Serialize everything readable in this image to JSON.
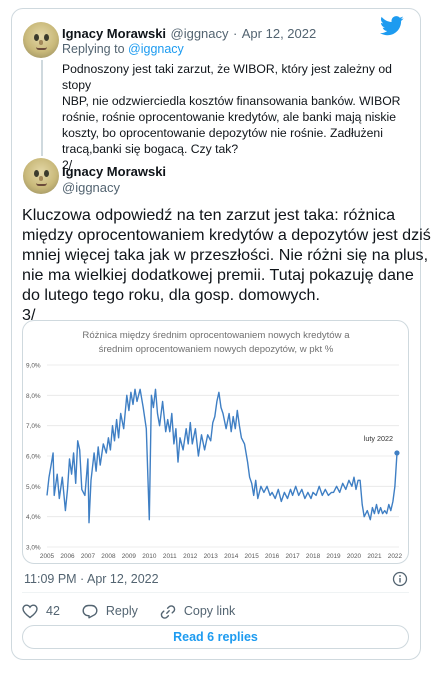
{
  "reply_tweet": {
    "author_name": "Ignacy Morawski",
    "handle": "@iggnacy",
    "dot": "·",
    "date": "Apr 12, 2022",
    "replying_prefix": "Replying to",
    "replying_to": "@iggnacy",
    "lines": [
      "Podnoszony jest taki zarzut, że WIBOR, który jest zależny od stopy",
      "NBP, nie odzwierciedla kosztów finansowania banków. WIBOR",
      "rośnie, rośnie oprocentowanie kredytów, ale banki mają niskie",
      "koszty, bo oprocentowanie depozytów nie rośnie. Zadłużeni",
      "tracą,banki się bogacą. Czy tak?",
      "2/"
    ]
  },
  "main_tweet": {
    "author_name": "Ignacy Morawski",
    "handle": "@iggnacy",
    "lines": [
      "Kluczowa odpowiedź na ten zarzut jest taka: różnica",
      "między oprocentowaniem kredytów a depozytów jest dziś",
      "mniej więcej taka jak w przeszłości. Nie różni się na plus,",
      "nie ma wielkiej dodatkowej premii. Tutaj pokazuję dane",
      "do lutego tego roku, dla gosp. domowych.",
      "3/"
    ],
    "timestamp": "11:09 PM · Apr 12, 2022",
    "like_count": "42",
    "reply_label": "Reply",
    "copy_link_label": "Copy link",
    "read_replies_label": "Read 6 replies"
  },
  "colors": {
    "line": "#3f7fc4",
    "twitter_blue": "#1d9bf0",
    "grid": "#e6e6e6"
  },
  "icons": {
    "logo": "twitter-bird-icon",
    "like": "heart-icon",
    "reply": "speech-bubble-icon",
    "copy_link": "link-icon",
    "info": "info-icon"
  },
  "chart_data": {
    "type": "line",
    "title": "Różnica między średnim oprocentowaniem nowych kredytów a średnim oprocentowaniem nowych depozytów, w pkt %",
    "title_lines": [
      "Różnica między średnim oprocentowaniem nowych kredytów a",
      "średnim oprocentowaniem nowych depozytów, w pkt %"
    ],
    "xlabel": "",
    "ylabel": "",
    "ylim": [
      3.0,
      9.0
    ],
    "xlim": [
      2005.0,
      2022.2
    ],
    "yticks": [
      "3,0%",
      "4,0%",
      "5,0%",
      "6,0%",
      "7,0%",
      "8,0%",
      "9,0%"
    ],
    "ytick_values": [
      3,
      4,
      5,
      6,
      7,
      8,
      9
    ],
    "xticks": [
      "2005",
      "2006",
      "2007",
      "2008",
      "2009",
      "2010",
      "2011",
      "2012",
      "2013",
      "2014",
      "2015",
      "2016",
      "2017",
      "2018",
      "2019",
      "2020",
      "2021",
      "2022"
    ],
    "grid": true,
    "annotation": "luty 2022",
    "last_point": [
      2022.1,
      6.1
    ],
    "series": [
      {
        "values": [
          [
            2005.0,
            4.7
          ],
          [
            2005.1,
            5.3
          ],
          [
            2005.2,
            5.7
          ],
          [
            2005.3,
            6.1
          ],
          [
            2005.35,
            4.7
          ],
          [
            2005.5,
            5.4
          ],
          [
            2005.6,
            4.6
          ],
          [
            2005.75,
            5.3
          ],
          [
            2005.9,
            4.2
          ],
          [
            2006.0,
            4.9
          ],
          [
            2006.1,
            5.9
          ],
          [
            2006.2,
            5.4
          ],
          [
            2006.3,
            6.1
          ],
          [
            2006.4,
            5.1
          ],
          [
            2006.5,
            6.5
          ],
          [
            2006.6,
            6.2
          ],
          [
            2006.7,
            4.9
          ],
          [
            2006.85,
            4.7
          ],
          [
            2007.0,
            5.9
          ],
          [
            2007.05,
            3.8
          ],
          [
            2007.15,
            5.2
          ],
          [
            2007.3,
            6.1
          ],
          [
            2007.4,
            5.5
          ],
          [
            2007.5,
            6.3
          ],
          [
            2007.6,
            5.7
          ],
          [
            2007.75,
            6.4
          ],
          [
            2007.9,
            6.1
          ],
          [
            2008.0,
            6.6
          ],
          [
            2008.1,
            6.2
          ],
          [
            2008.2,
            7.0
          ],
          [
            2008.3,
            6.5
          ],
          [
            2008.4,
            7.2
          ],
          [
            2008.5,
            6.6
          ],
          [
            2008.6,
            7.4
          ],
          [
            2008.75,
            6.9
          ],
          [
            2008.9,
            8.0
          ],
          [
            2009.0,
            7.5
          ],
          [
            2009.1,
            8.1
          ],
          [
            2009.2,
            7.7
          ],
          [
            2009.3,
            8.2
          ],
          [
            2009.4,
            7.8
          ],
          [
            2009.55,
            8.2
          ],
          [
            2009.7,
            7.6
          ],
          [
            2009.85,
            6.9
          ],
          [
            2010.0,
            3.9
          ],
          [
            2010.1,
            8.0
          ],
          [
            2010.2,
            7.6
          ],
          [
            2010.3,
            8.2
          ],
          [
            2010.4,
            7.4
          ],
          [
            2010.5,
            7.0
          ],
          [
            2010.65,
            7.8
          ],
          [
            2010.8,
            6.8
          ],
          [
            2010.9,
            7.2
          ],
          [
            2011.0,
            6.8
          ],
          [
            2011.1,
            7.4
          ],
          [
            2011.2,
            6.4
          ],
          [
            2011.3,
            6.9
          ],
          [
            2011.4,
            5.8
          ],
          [
            2011.5,
            6.6
          ],
          [
            2011.65,
            6.2
          ],
          [
            2011.8,
            6.9
          ],
          [
            2011.9,
            6.4
          ],
          [
            2012.0,
            7.1
          ],
          [
            2012.1,
            6.4
          ],
          [
            2012.25,
            6.9
          ],
          [
            2012.4,
            6.0
          ],
          [
            2012.55,
            6.7
          ],
          [
            2012.7,
            6.2
          ],
          [
            2012.85,
            6.7
          ],
          [
            2013.0,
            6.5
          ],
          [
            2013.1,
            7.1
          ],
          [
            2013.2,
            7.3
          ],
          [
            2013.3,
            7.8
          ],
          [
            2013.4,
            8.1
          ],
          [
            2013.5,
            7.6
          ],
          [
            2013.6,
            7.4
          ],
          [
            2013.75,
            6.9
          ],
          [
            2013.9,
            7.4
          ],
          [
            2014.0,
            6.8
          ],
          [
            2014.1,
            7.3
          ],
          [
            2014.2,
            6.9
          ],
          [
            2014.3,
            7.5
          ],
          [
            2014.4,
            7.0
          ],
          [
            2014.5,
            6.6
          ],
          [
            2014.65,
            6.4
          ],
          [
            2014.8,
            5.8
          ],
          [
            2014.9,
            5.3
          ],
          [
            2015.0,
            5.1
          ],
          [
            2015.1,
            4.7
          ],
          [
            2015.2,
            5.2
          ],
          [
            2015.3,
            4.6
          ],
          [
            2015.45,
            5.0
          ],
          [
            2015.6,
            4.8
          ],
          [
            2015.75,
            5.0
          ],
          [
            2015.9,
            4.7
          ],
          [
            2016.0,
            4.8
          ],
          [
            2016.15,
            4.6
          ],
          [
            2016.3,
            4.9
          ],
          [
            2016.45,
            4.5
          ],
          [
            2016.6,
            4.8
          ],
          [
            2016.75,
            4.6
          ],
          [
            2016.9,
            4.9
          ],
          [
            2017.0,
            4.7
          ],
          [
            2017.15,
            5.0
          ],
          [
            2017.3,
            4.7
          ],
          [
            2017.45,
            4.9
          ],
          [
            2017.6,
            4.6
          ],
          [
            2017.75,
            4.8
          ],
          [
            2017.9,
            4.6
          ],
          [
            2018.0,
            4.8
          ],
          [
            2018.15,
            4.7
          ],
          [
            2018.3,
            5.0
          ],
          [
            2018.45,
            4.7
          ],
          [
            2018.6,
            4.9
          ],
          [
            2018.75,
            4.7
          ],
          [
            2018.9,
            4.8
          ],
          [
            2019.0,
            4.8
          ],
          [
            2019.15,
            5.0
          ],
          [
            2019.3,
            4.8
          ],
          [
            2019.45,
            5.1
          ],
          [
            2019.6,
            4.9
          ],
          [
            2019.75,
            5.2
          ],
          [
            2019.9,
            5.0
          ],
          [
            2020.0,
            5.3
          ],
          [
            2020.1,
            4.9
          ],
          [
            2020.2,
            5.2
          ],
          [
            2020.3,
            5.2
          ],
          [
            2020.4,
            4.4
          ],
          [
            2020.5,
            4.0
          ],
          [
            2020.65,
            4.2
          ],
          [
            2020.8,
            3.9
          ],
          [
            2020.9,
            4.3
          ],
          [
            2021.0,
            4.1
          ],
          [
            2021.1,
            4.4
          ],
          [
            2021.2,
            4.1
          ],
          [
            2021.3,
            4.3
          ],
          [
            2021.4,
            4.1
          ],
          [
            2021.5,
            4.2
          ],
          [
            2021.6,
            4.1
          ],
          [
            2021.7,
            4.4
          ],
          [
            2021.8,
            4.2
          ],
          [
            2021.9,
            4.5
          ],
          [
            2022.0,
            5.0
          ],
          [
            2022.1,
            6.1
          ]
        ]
      }
    ]
  }
}
